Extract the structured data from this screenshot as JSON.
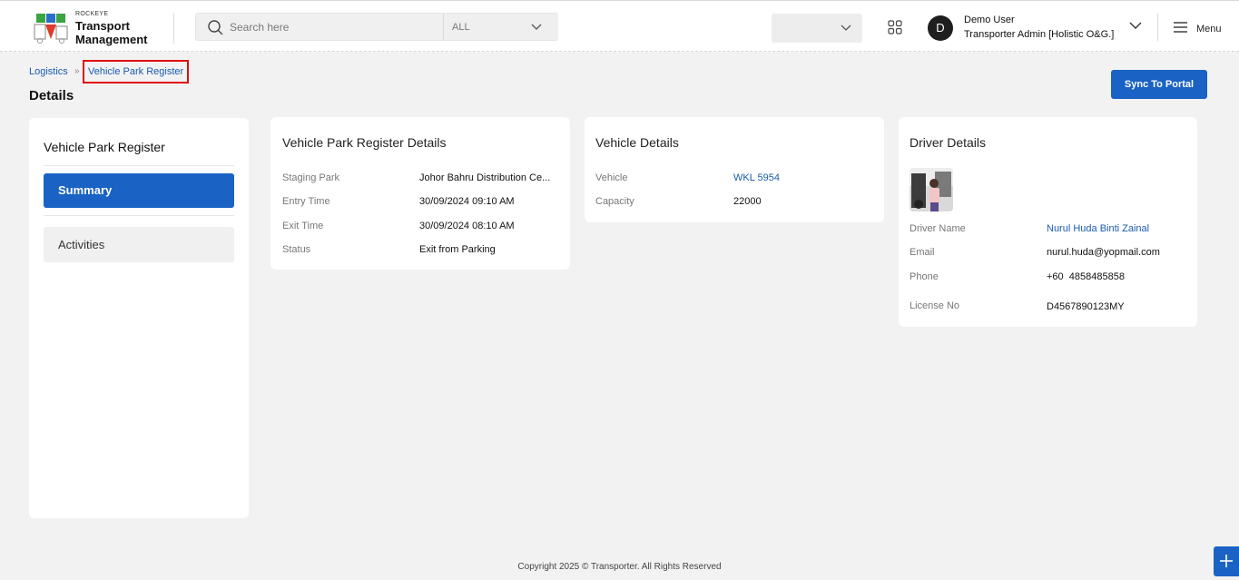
{
  "header": {
    "logo_small": "ROCKEYE",
    "logo_line1": "Transport",
    "logo_line2": "Management",
    "search_placeholder": "Search here",
    "search_scope": "ALL",
    "apps_icon": "grid-icon",
    "menu_icon": "hamburger-icon",
    "menu_label": "Menu",
    "user": {
      "initial": "D",
      "name": "Demo User",
      "role": "Transporter Admin [Holistic O&G.]"
    }
  },
  "breadcrumb": {
    "parent": "Logistics",
    "separator": "»",
    "current": "Vehicle Park Register"
  },
  "page": {
    "title": "Details",
    "sync_button": "Sync To Portal"
  },
  "sidebar": {
    "title": "Vehicle Park Register",
    "items": [
      {
        "label": "Summary",
        "active": true
      },
      {
        "label": "Activities",
        "active": false
      }
    ]
  },
  "register_details": {
    "title": "Vehicle Park Register Details",
    "rows": [
      {
        "label": "Staging Park",
        "value": "Johor Bahru Distribution Ce..."
      },
      {
        "label": "Entry Time",
        "value": "30/09/2024 09:10 AM"
      },
      {
        "label": "Exit Time",
        "value": "30/09/2024 08:10 AM"
      },
      {
        "label": "Status",
        "value": "Exit from Parking"
      }
    ]
  },
  "vehicle_details": {
    "title": "Vehicle Details",
    "rows": [
      {
        "label": "Vehicle",
        "value": "WKL 5954"
      },
      {
        "label": "Capacity",
        "value": "22000"
      }
    ]
  },
  "driver_details": {
    "title": "Driver Details",
    "rows": [
      {
        "label": "Driver Name",
        "value": "Nurul Huda Binti Zainal"
      },
      {
        "label": "Email",
        "value": "nurul.huda@yopmail.com"
      },
      {
        "label": "Phone",
        "value": "+60  4858485858"
      },
      {
        "label": "License No",
        "value": "D4567890123MY"
      }
    ]
  },
  "footer": {
    "copyright": "Copyright 2025 © Transporter. All Rights Reserved"
  },
  "colors": {
    "primary": "#1a62c4",
    "link": "#1a5bb0",
    "highlight_border": "#e01010",
    "background": "#f2f2f2"
  }
}
